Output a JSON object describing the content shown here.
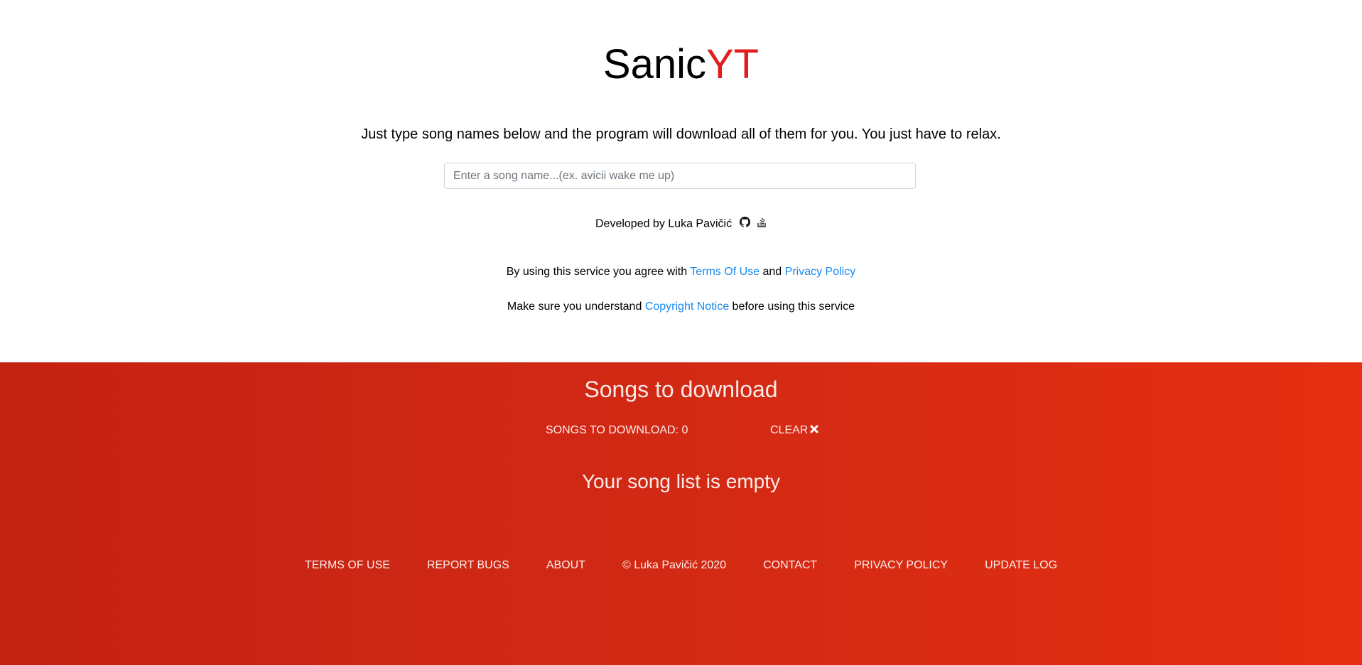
{
  "brand": {
    "part1": "Sanic",
    "part2": "YT",
    "accent_color": "#e11d1d"
  },
  "tagline": "Just type song names below and the program will download all of them for you. You just have to relax.",
  "search": {
    "placeholder": "Enter a song name...(ex. avicii wake me up)",
    "value": ""
  },
  "developer": {
    "text": "Developed by Luka Pavičić",
    "icons": [
      "github-icon",
      "stackoverflow-icon"
    ]
  },
  "legal": {
    "line1_prefix": "By using this service you agree with",
    "terms_link": "Terms Of Use",
    "and": "and",
    "privacy_link": "Privacy Policy",
    "line2_prefix": "Make sure you understand",
    "copyright_link": "Copyright Notice",
    "line2_suffix": "before using this service"
  },
  "songs": {
    "title": "Songs to download",
    "count_label": "SONGS TO DOWNLOAD: 0",
    "clear_label": "CLEAR",
    "empty_message": "Your song list is empty"
  },
  "footer": {
    "items": [
      "TERMS OF USE",
      "REPORT BUGS",
      "ABOUT",
      "© Luka Pavičić 2020",
      "CONTACT",
      "PRIVACY POLICY",
      "UPDATE LOG"
    ]
  },
  "colors": {
    "link": "#1a8bf0",
    "band_start": "#c42213",
    "band_end": "#e52f11"
  }
}
